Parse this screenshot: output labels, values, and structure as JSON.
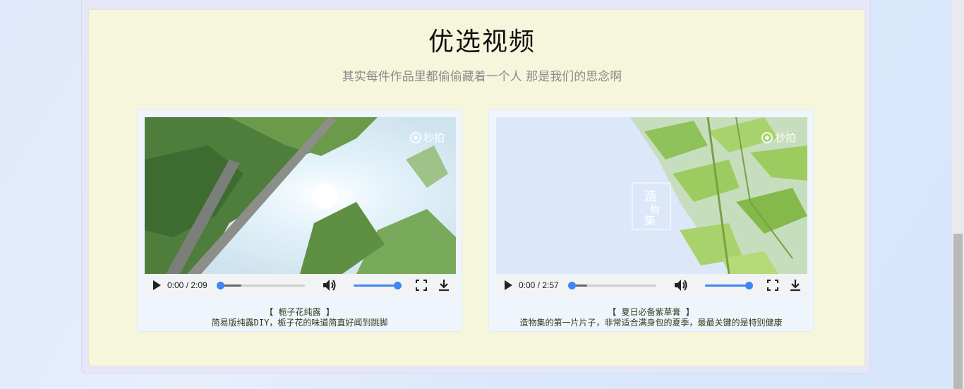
{
  "section": {
    "title": "优选视频",
    "subtitle": "其实每件作品里都偷偷藏着一个人 那是我们的思念啊"
  },
  "videos": [
    {
      "watermark": "秒拍",
      "time": "0:00 / 2:09",
      "progress": 0,
      "volume": 1,
      "title": "【 栀子花纯露 】",
      "description": "简易版纯露DIY，栀子花的味道简直好闻到跳脚"
    },
    {
      "watermark": "秒拍",
      "time": "0:00 / 2:57",
      "progress": 0,
      "volume": 1,
      "title": "【 夏日必备紫草膏 】",
      "description": "造物集的第一片片子，非常适合满身包的夏季，最最关键的是特别健康"
    }
  ],
  "colors": {
    "section_bg": "#f5f6dc",
    "accent": "#4285f4"
  }
}
